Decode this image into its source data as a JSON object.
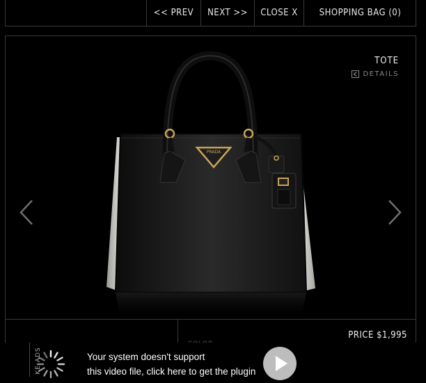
{
  "nav": {
    "prev": "<< PREV",
    "next": "NEXT >>",
    "close": "CLOSE X",
    "shopping_bag": "SHOPPING BAG (0)"
  },
  "product": {
    "title": "TOTE",
    "details_label": "DETAILS",
    "brand_plate": "PRADA",
    "price": "PRICE $1,995",
    "color_label": "COLOR"
  },
  "plugin": {
    "ads_label": "KE ADS",
    "line1": "Your system doesn't support",
    "line2": "this video file, click here to get the plugin"
  },
  "colors": {
    "background": "#000000",
    "border": "#3a3a3a",
    "bag_body": "#1a1a1a",
    "bag_sides": "#e6e6e2",
    "hardware_gold": "#c9a45a"
  },
  "icons": {
    "details": "chevron-left-box-icon",
    "prev_arrow": "chevron-left-icon",
    "next_arrow": "chevron-right-icon",
    "spinner": "loading-spinner-icon",
    "play": "play-icon"
  }
}
